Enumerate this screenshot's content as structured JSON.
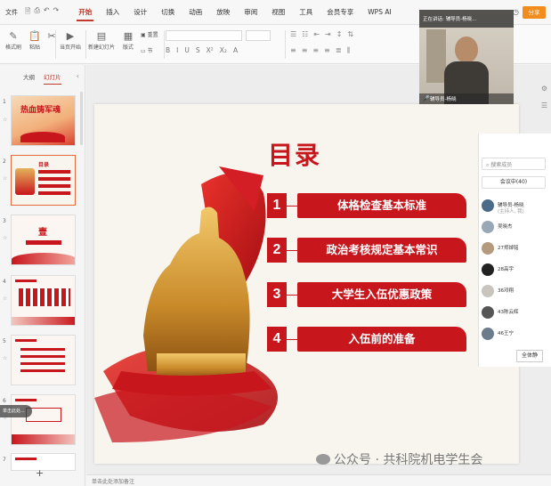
{
  "menubar": {
    "file": "文件",
    "tabs": [
      {
        "label": "开始",
        "active": true
      },
      {
        "label": "插入"
      },
      {
        "label": "设计"
      },
      {
        "label": "切换"
      },
      {
        "label": "动画"
      },
      {
        "label": "放映"
      },
      {
        "label": "审阅"
      },
      {
        "label": "视图"
      },
      {
        "label": "工具"
      },
      {
        "label": "会员专享"
      },
      {
        "label": "WPS AI"
      }
    ],
    "share": "分享"
  },
  "ribbon": {
    "format_painter": "格式刷",
    "paste": "粘贴",
    "play": "当页开始",
    "new_slide": "新建幻灯片",
    "layout": "版式",
    "section": "节",
    "reset": "重置"
  },
  "left_panel": {
    "tab_outline": "大纲",
    "tab_slides": "幻灯片",
    "thumb1_title": "热血铸军魂",
    "thumb2_title": "目录",
    "thumb3_title": "壹",
    "add": "+"
  },
  "slide": {
    "title": "目录",
    "items": [
      {
        "num": "1",
        "text": "体格检查基本标准"
      },
      {
        "num": "2",
        "text": "政治考核规定基本常识"
      },
      {
        "num": "3",
        "text": "大学生入伍优惠政策"
      },
      {
        "num": "4",
        "text": "入伍前的准备"
      }
    ]
  },
  "video": {
    "top": "正在讲话:  辅导员-杨晓...",
    "bottom": "辅导员-杨晓"
  },
  "members": {
    "search_placeholder": "搜索成员",
    "meeting_btn": "会议中(40)",
    "list": [
      {
        "name": "辅导员-杨晓",
        "sub": "(主持人, 我)"
      },
      {
        "name": "吴晓杰",
        "sub": ""
      },
      {
        "name": "27郑焯铭",
        "sub": ""
      },
      {
        "name": "28高宇",
        "sub": ""
      },
      {
        "name": "36邓翔",
        "sub": ""
      },
      {
        "name": "43陈云辉",
        "sub": ""
      },
      {
        "name": "46王宁",
        "sub": ""
      }
    ],
    "mute_all": "全体静"
  },
  "footer": {
    "notes": "单击此处添加备注"
  },
  "watermark": "公众号 · 共科院机电学生会",
  "side_float": "单击此处..."
}
